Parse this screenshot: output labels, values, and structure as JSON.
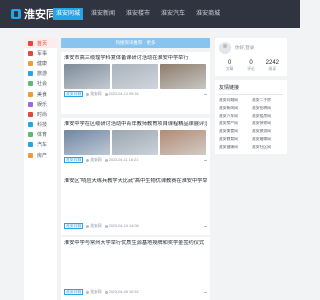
{
  "header": {
    "logo_text": "淮安同城",
    "nav": [
      {
        "label": "淮安同城",
        "active": true
      },
      {
        "label": "淮安新闻",
        "active": false
      },
      {
        "label": "淮安楼市",
        "active": false
      },
      {
        "label": "淮安汽车",
        "active": false
      },
      {
        "label": "淮安商城",
        "active": false
      }
    ]
  },
  "sidebar": {
    "items": [
      {
        "label": "首页",
        "icon": "home-icon",
        "color": "#e2483d",
        "active": true
      },
      {
        "label": "军事",
        "icon": "shield-icon",
        "color": "#e2483d"
      },
      {
        "label": "健康",
        "icon": "heart-icon",
        "color": "#f09a3e"
      },
      {
        "label": "旅游",
        "icon": "plane-icon",
        "color": "#27a3e8"
      },
      {
        "label": "社会",
        "icon": "people-icon",
        "color": "#5fb878"
      },
      {
        "label": "美食",
        "icon": "food-icon",
        "color": "#f09a3e"
      },
      {
        "label": "娱乐",
        "icon": "music-icon",
        "color": "#9c6ade"
      },
      {
        "label": "时尚",
        "icon": "star-icon",
        "color": "#e2483d"
      },
      {
        "label": "科技",
        "icon": "chip-icon",
        "color": "#27a3e8"
      },
      {
        "label": "体育",
        "icon": "ball-icon",
        "color": "#5fb878"
      },
      {
        "label": "汽车",
        "icon": "car-icon",
        "color": "#27a3e8"
      },
      {
        "label": "房产",
        "icon": "house-icon",
        "color": "#f09a3e"
      }
    ]
  },
  "banner": {
    "text": "热搜资讯推荐 · 更多"
  },
  "articles": [
    {
      "title": "淮安市高三级理学科复体备课研讨活动在淮安中学举行",
      "thumbs": [
        "#7d8c9a",
        "#a9b3bd",
        "#8e7d6c"
      ],
      "tag": "淮安同城",
      "author": "淮安网",
      "time": "2023-04-12 09:34"
    },
    {
      "title": "淮安中学在区级研讨活动中青年教师教育项目课程精品课展评活动",
      "thumbs": [
        "#6f86a3",
        "#9aa6b0",
        "#b28b74"
      ],
      "tag": "淮安同城",
      "author": "淮安网",
      "time": "2023-04-11 16:21"
    },
    {
      "title": "淮安区“响应大练兵教学大比武”高中生物优课教赛在淮安中学举行",
      "thumbs": [],
      "tag": "淮安同城",
      "author": "淮安网",
      "time": "2023-04-10 14:08"
    },
    {
      "title": "淮安中学与常州大学举行优质生源基地授牌和奖学金签约仪式",
      "thumbs": [],
      "tag": "淮安同城",
      "author": "淮安网",
      "time": "2023-04-09 10:52"
    }
  ],
  "user_card": {
    "name": "你好,登录",
    "stats": [
      {
        "num": "0",
        "label": "文章"
      },
      {
        "num": "0",
        "label": "评论"
      },
      {
        "num": "2242",
        "label": "阅读"
      }
    ]
  },
  "links": {
    "title": "友情链接",
    "items": [
      "淮安同城网",
      "淮安二手房",
      "淮安新闻网",
      "淮安招聘网",
      "淮安汽车网",
      "淮安租房网",
      "淮安房产网",
      "淮安装修网",
      "淮安美食网",
      "淮安旅游网",
      "淮安教育网",
      "淮安婚嫁网",
      "淮安健康网",
      "淮安社区网"
    ]
  }
}
